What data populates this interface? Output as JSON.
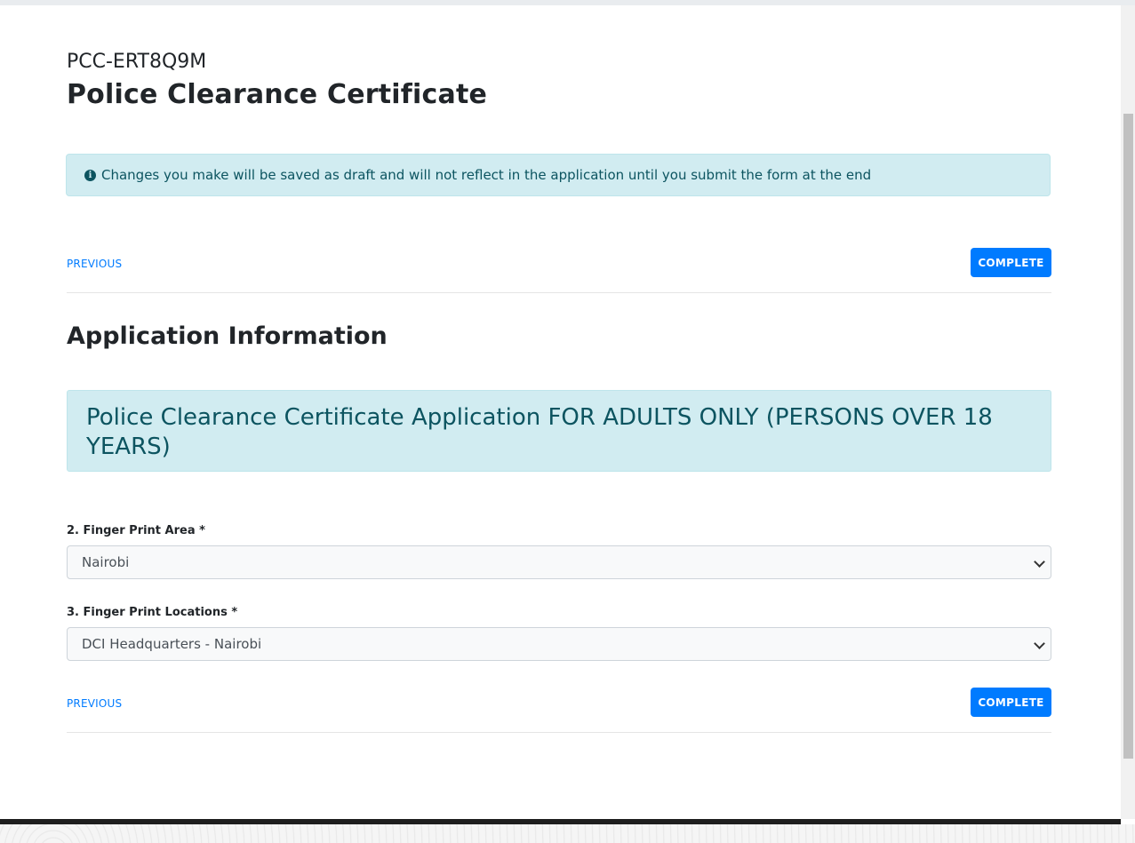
{
  "application": {
    "reference_code": "PCC-ERT8Q9M",
    "title": "Police Clearance Certificate"
  },
  "notice": {
    "icon": "info-circle-icon",
    "text": "Changes you make will be saved as draft and will not reflect in the application until you submit the form at the end"
  },
  "navigation": {
    "previous_label": "PREVIOUS",
    "complete_label": "COMPLETE"
  },
  "section": {
    "title": "Application Information",
    "banner_text": "Police Clearance Certificate Application FOR ADULTS ONLY (PERSONS OVER 18 YEARS)"
  },
  "form": {
    "finger_print_area": {
      "label": "2. Finger Print Area *",
      "value": "Nairobi"
    },
    "finger_print_location": {
      "label": "3. Finger Print Locations *",
      "value": "DCI Headquarters - Nairobi"
    }
  },
  "colors": {
    "primary": "#007bff",
    "info_bg": "#d1ecf1",
    "info_text": "#0c5460"
  }
}
